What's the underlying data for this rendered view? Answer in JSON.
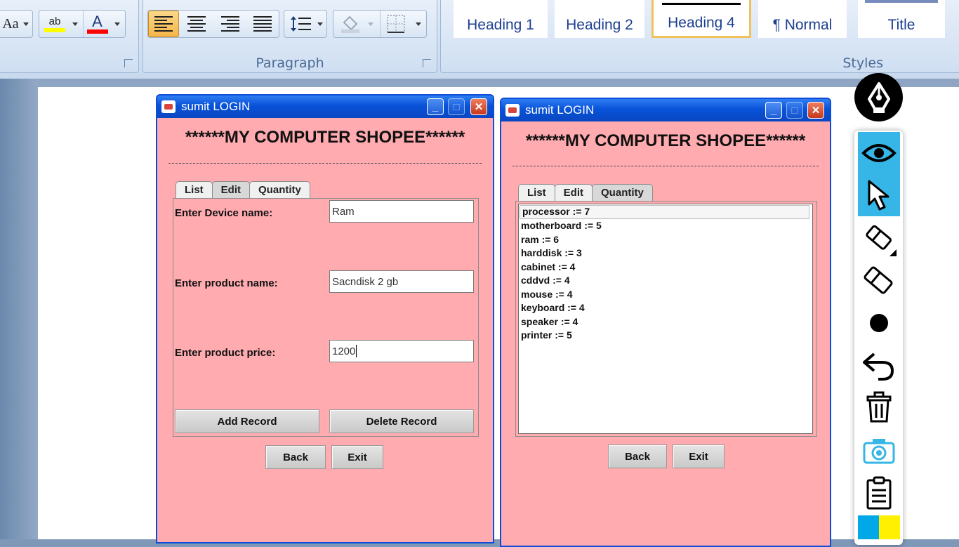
{
  "ribbon": {
    "font_group": {
      "change_case_label": "Aa",
      "highlight_label": "ab",
      "font_color_label": "A"
    },
    "paragraph_group": {
      "label": "Paragraph"
    },
    "styles_group": {
      "label": "Styles",
      "items": [
        {
          "label": "Heading 1",
          "selected": false
        },
        {
          "label": "Heading 2",
          "selected": false
        },
        {
          "label": "Heading 4",
          "selected": true
        },
        {
          "label": "¶ Normal",
          "selected": false
        },
        {
          "label": "Title",
          "selected": false
        }
      ]
    }
  },
  "window_left": {
    "title": "sumit LOGIN",
    "heading": "******MY COMPUTER SHOPEE******",
    "tabs": [
      {
        "label": "List"
      },
      {
        "label": "Edit"
      },
      {
        "label": "Quantity"
      }
    ],
    "active_tab": "Edit",
    "fields": [
      {
        "label": "Enter Device name:",
        "value": "Ram"
      },
      {
        "label": "Enter product name:",
        "value": "Sacndisk 2 gb"
      },
      {
        "label": "Enter product price:",
        "value": "1200"
      }
    ],
    "actions": {
      "add": "Add Record",
      "delete": "Delete Record"
    },
    "nav": {
      "back": "Back",
      "exit": "Exit"
    }
  },
  "window_right": {
    "title": "sumit LOGIN",
    "heading": "******MY COMPUTER SHOPEE******",
    "tabs": [
      {
        "label": "List"
      },
      {
        "label": "Edit"
      },
      {
        "label": "Quantity"
      }
    ],
    "active_tab": "Quantity",
    "list": [
      "processor := 7",
      "motherboard := 5",
      "ram := 6",
      "harddisk := 3",
      "cabinet := 4",
      "cddvd := 4",
      "mouse := 4",
      "keyboard := 4",
      "speaker := 4",
      "printer := 5"
    ],
    "nav": {
      "back": "Back",
      "exit": "Exit"
    }
  },
  "annotation_toolbar": {
    "tools": [
      "pen-logo-icon",
      "eye-icon",
      "cursor-icon",
      "eraser-options-icon",
      "eraser-icon",
      "dot-icon",
      "undo-icon",
      "trash-icon",
      "camera-icon",
      "clipboard-icon",
      "color-swatch-icon"
    ],
    "accent": "#35b6e6"
  },
  "colors": {
    "window_bg": "#ffabb0",
    "titlebar": "#0852d8",
    "style_text": "#1c3f91"
  }
}
